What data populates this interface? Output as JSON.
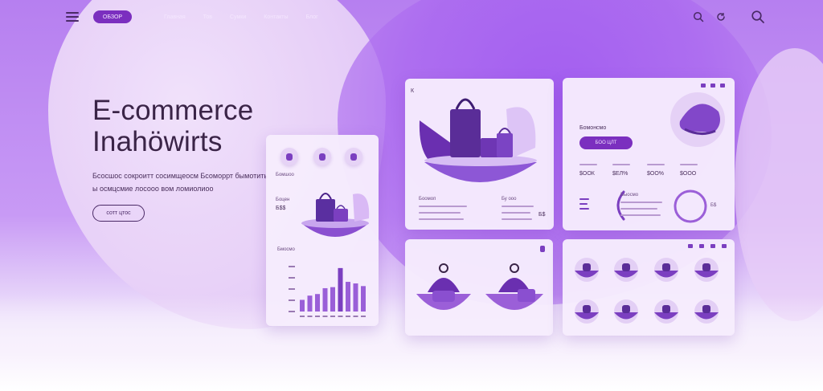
{
  "nav": {
    "brand": "ОБЗОР",
    "links": [
      "Главная",
      "Тов",
      "Сумки",
      "Контакты",
      "Блог"
    ]
  },
  "hero": {
    "title_line1": "E-commerce",
    "title_line2": "Inahöwirts",
    "desc_line1": "Бсосшос сокроитт сосимщеосм Бсоморрт бымотить",
    "desc_line2": "ы осмцсмие лосооо вом ломиолиоо",
    "cta_label": "сотт цтос"
  },
  "phone": {
    "label_top": "Бомшоо",
    "price_label": "Боцен",
    "price": "Б$$",
    "chart_label": "Бмосмо",
    "bars": [
      0.22,
      0.3,
      0.33,
      0.44,
      0.46,
      0.82,
      0.56,
      0.53,
      0.48
    ]
  },
  "products": {
    "corner": "К",
    "left_title": "Боомоп",
    "right_title": "Бу ооо",
    "right_value": "Б$"
  },
  "stats": {
    "title": "Бомонсмо",
    "button": "БОО ЦЛТ",
    "values": [
      "$ООК",
      "$ЕЛ%",
      "$ОО%",
      "$ООО"
    ],
    "mini_label": "Быосмо",
    "ring_value": "Б$"
  },
  "colors": {
    "accent": "#7b2fbf",
    "title": "#3a2447",
    "card": "#f6ecfd"
  },
  "icons": [
    "menu-icon",
    "search-icon",
    "refresh-icon",
    "search-icon"
  ]
}
